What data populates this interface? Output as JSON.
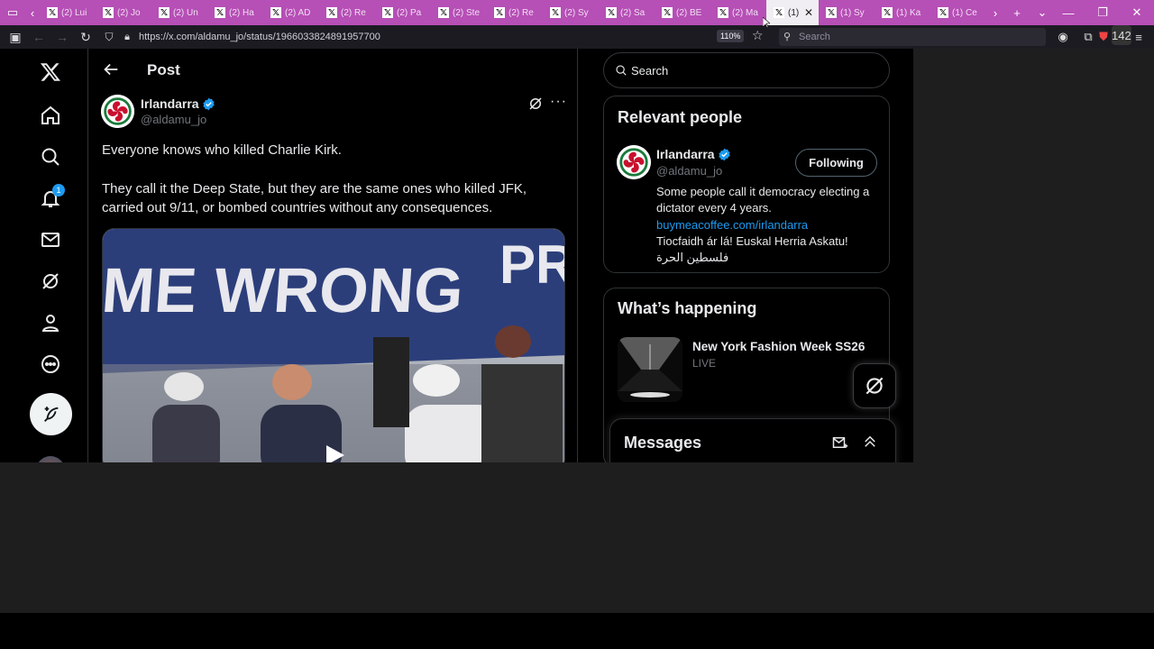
{
  "browser": {
    "tabs": [
      {
        "label": "(2) Lui"
      },
      {
        "label": "(2) Jo"
      },
      {
        "label": "(2) Un"
      },
      {
        "label": "(2) Ha"
      },
      {
        "label": "(2) AD"
      },
      {
        "label": "(2) Re"
      },
      {
        "label": "(2) Pa"
      },
      {
        "label": "(2) Ste"
      },
      {
        "label": "(2) Re"
      },
      {
        "label": "(2) Sy"
      },
      {
        "label": "(2) Sa"
      },
      {
        "label": "(2) BE"
      },
      {
        "label": "(2) Ma"
      },
      {
        "label": "(1)",
        "active": true
      },
      {
        "label": "(1) Sy"
      },
      {
        "label": "(1) Ka"
      },
      {
        "label": "(1) Ce"
      }
    ],
    "url": "https://x.com/aldamu_jo/status/1966033824891957700",
    "zoom": "110%",
    "search_placeholder": "Search",
    "extension_badge": "142"
  },
  "nav": {
    "notification_count": "1"
  },
  "post": {
    "header_title": "Post",
    "author_name": "Irlandarra",
    "author_handle": "@aldamu_jo",
    "paragraphs": [
      "Everyone knows who killed Charlie Kirk.",
      "They call it the Deep State, but they are the same ones who killed JFK, carried out 9/11, or bombed countries without any consequences."
    ],
    "video_banner_text": "ME WRONG",
    "video_banner_text2": "PR"
  },
  "sidebar": {
    "search_placeholder": "Search",
    "relevant_people": {
      "title": "Relevant people",
      "name": "Irlandarra",
      "handle": "@aldamu_jo",
      "follow_label": "Following",
      "bio_line1": "Some people call it democracy electing a dictator every 4 years.",
      "bio_link": "buymeacoffee.com/irlandarra",
      "bio_line2": "Tiocfaidh ár lá! Euskal Herria Askatu!",
      "bio_line3": "فلسطين الحرة"
    },
    "whats_happening": {
      "title": "What’s happening",
      "trend_title": "New York Fashion Week SS26",
      "trend_sub": "LIVE"
    },
    "messages": {
      "title": "Messages"
    }
  },
  "colors": {
    "tabbar": "#b64fb6",
    "accent": "#1d9bf0",
    "background": "#000000",
    "text": "#e7e9ea",
    "muted": "#71767b"
  }
}
